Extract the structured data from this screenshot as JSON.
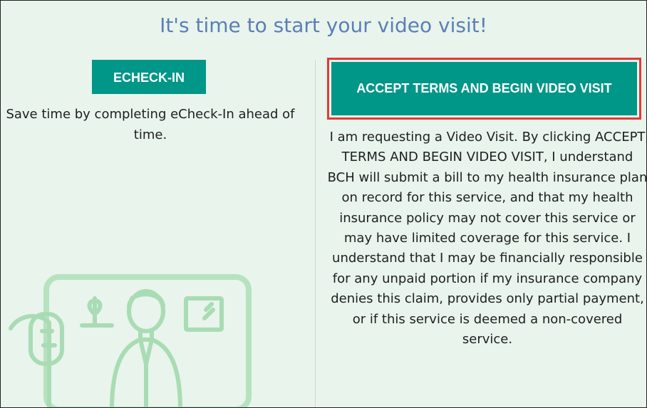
{
  "title": "It's time to start your video visit!",
  "left": {
    "echeck_label": "ECHECK-IN",
    "description": "Save time by completing eCheck-In ahead of time."
  },
  "right": {
    "accept_label": "ACCEPT TERMS AND BEGIN VIDEO VISIT",
    "terms_text": "I am requesting a Video Visit. By clicking ACCEPT TERMS AND BEGIN VIDEO VISIT, I understand BCH will submit a bill to my health insurance plan on record for this service, and that my health insurance policy may not cover this service or may have limited coverage for this service. I understand that I may be financially responsible for any unpaid portion if my insurance company denies this claim, provides only partial payment, or if this service is deemed a non-covered service."
  },
  "colors": {
    "accent": "#009688",
    "title": "#5b7fb6",
    "highlight": "#e53935",
    "background": "#e8f4ec"
  },
  "icons": {
    "illustration": "video-visit-illustration-icon"
  }
}
